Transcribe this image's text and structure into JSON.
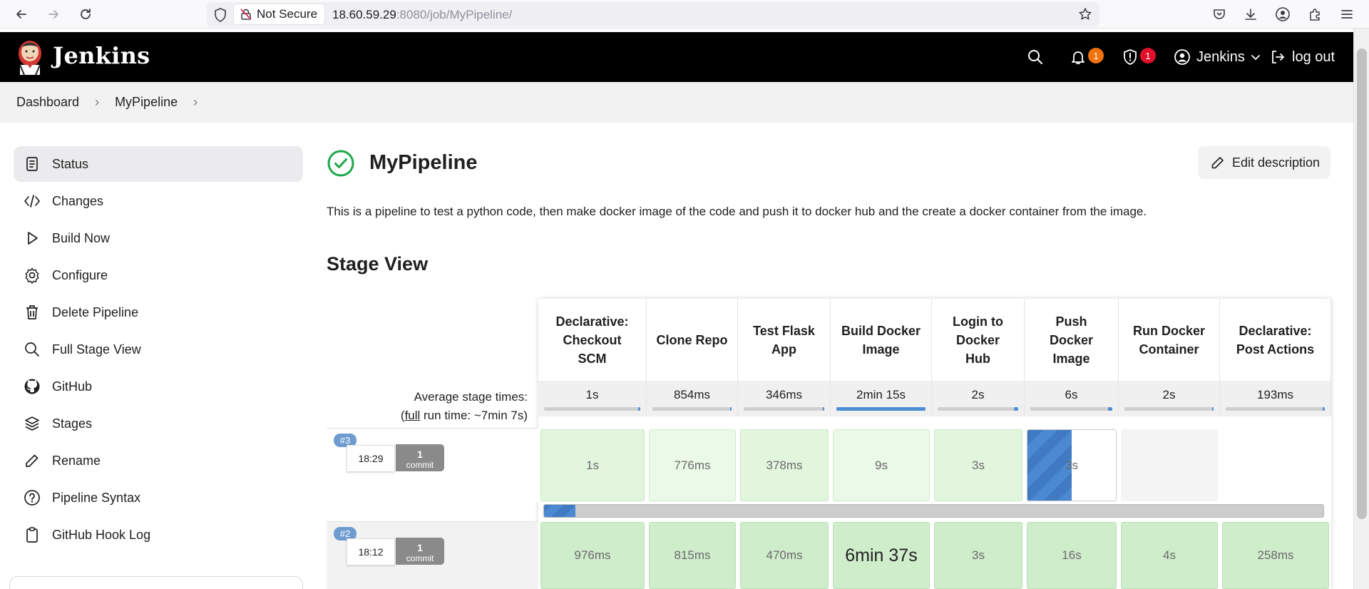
{
  "browser": {
    "security_label": "Not Secure",
    "url_host": "18.60.59.29",
    "url_rest": ":8080/job/MyPipeline/"
  },
  "header": {
    "app_name": "Jenkins",
    "notifications_count": "1",
    "security_count": "1",
    "user_name": "Jenkins",
    "logout_label": "log out",
    "notification_badge_color": "#f0720c",
    "security_badge_color": "#e0102d"
  },
  "breadcrumb": {
    "items": [
      "Dashboard",
      "MyPipeline"
    ]
  },
  "sidebar": {
    "items": [
      {
        "label": "Status",
        "icon": "document-icon"
      },
      {
        "label": "Changes",
        "icon": "code-icon"
      },
      {
        "label": "Build Now",
        "icon": "play-icon"
      },
      {
        "label": "Configure",
        "icon": "gear-icon"
      },
      {
        "label": "Delete Pipeline",
        "icon": "trash-icon"
      },
      {
        "label": "Full Stage View",
        "icon": "search-icon"
      },
      {
        "label": "GitHub",
        "icon": "github-icon"
      },
      {
        "label": "Stages",
        "icon": "layers-icon"
      },
      {
        "label": "Rename",
        "icon": "pencil-icon"
      },
      {
        "label": "Pipeline Syntax",
        "icon": "help-icon"
      },
      {
        "label": "GitHub Hook Log",
        "icon": "clipboard-icon"
      }
    ]
  },
  "main": {
    "title": "MyPipeline",
    "edit_description_label": "Edit description",
    "description": "This is a pipeline to test a python code, then make docker image of the code and push it to docker hub and the create a docker container from the image.",
    "stage_view_title": "Stage View",
    "status_color": "#1ea64b"
  },
  "stage_view": {
    "avg_label": "Average stage times:",
    "full_run_prefix": "(",
    "full_run_link": "full",
    "full_run_suffix": " run time: ~7min 7s)",
    "stages": [
      {
        "name": "Declarative: Checkout SCM",
        "lines": [
          "Declarative:",
          "Checkout",
          "SCM"
        ],
        "avg": "1s",
        "avg_fraction": 0.02
      },
      {
        "name": "Clone Repo",
        "lines": [
          "Clone Repo"
        ],
        "avg": "854ms",
        "avg_fraction": 0.01
      },
      {
        "name": "Test Flask App",
        "lines": [
          "Test Flask",
          "App"
        ],
        "avg": "346ms",
        "avg_fraction": 0.01
      },
      {
        "name": "Build Docker Image",
        "lines": [
          "Build Docker",
          "Image"
        ],
        "avg": "2min 15s",
        "avg_fraction": 1.0
      },
      {
        "name": "Login to Docker Hub",
        "lines": [
          "Login to",
          "Docker",
          "Hub"
        ],
        "avg": "2s",
        "avg_fraction": 0.05
      },
      {
        "name": "Push Docker Image",
        "lines": [
          "Push",
          "Docker",
          "Image"
        ],
        "avg": "6s",
        "avg_fraction": 0.05
      },
      {
        "name": "Run Docker Container",
        "lines": [
          "Run Docker",
          "Container"
        ],
        "avg": "2s",
        "avg_fraction": 0.02
      },
      {
        "name": "Declarative: Post Actions",
        "lines": [
          "Declarative:",
          "Post Actions"
        ],
        "avg": "193ms",
        "avg_fraction": 0.01
      }
    ],
    "runs": [
      {
        "number": "#3",
        "time": "18:29",
        "commits": "1",
        "commit_word": "commit",
        "progress_fraction": 0.04,
        "cells": [
          {
            "text": "1s",
            "state": "ok1"
          },
          {
            "text": "776ms",
            "state": "ok2"
          },
          {
            "text": "378ms",
            "state": "ok1"
          },
          {
            "text": "9s",
            "state": "ok2"
          },
          {
            "text": "3s",
            "state": "ok1"
          },
          {
            "text": "3s",
            "state": "running",
            "progress_fraction": 0.5
          },
          {
            "text": "",
            "state": "empty1"
          },
          {
            "text": "",
            "state": "empty2"
          }
        ]
      },
      {
        "number": "#2",
        "time": "18:12",
        "commits": "1",
        "commit_word": "commit",
        "cells": [
          {
            "text": "976ms",
            "state": "ok3"
          },
          {
            "text": "815ms",
            "state": "ok3"
          },
          {
            "text": "470ms",
            "state": "ok3"
          },
          {
            "text": "6min 37s",
            "state": "ok3",
            "big": true
          },
          {
            "text": "3s",
            "state": "ok3"
          },
          {
            "text": "16s",
            "state": "ok3"
          },
          {
            "text": "4s",
            "state": "ok3"
          },
          {
            "text": "258ms",
            "state": "ok3"
          }
        ]
      }
    ]
  }
}
